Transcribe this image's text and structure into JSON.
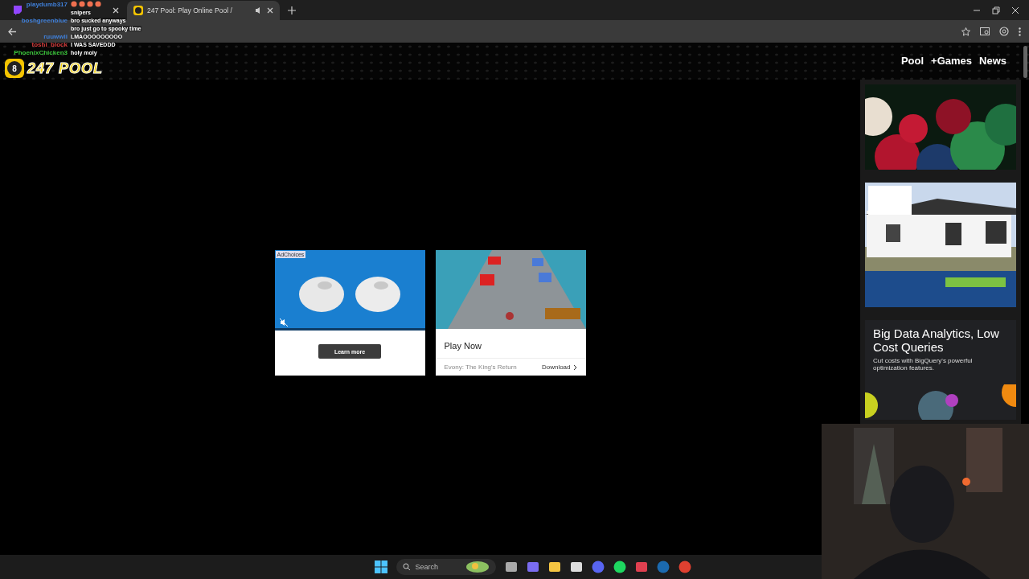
{
  "browser": {
    "tabs": [
      {
        "kind": "twitch",
        "selected": false
      },
      {
        "kind": "site",
        "title": "247 Pool: Play Online Pool /",
        "audio": true,
        "selected": true
      }
    ]
  },
  "site": {
    "logo_ball": "8",
    "logo_text": "247 POOL",
    "nav": [
      "Pool",
      "+Games",
      "News"
    ]
  },
  "center_ads": [
    {
      "kind": "video",
      "adchoices": "AdChoices",
      "muted": true,
      "button": "Learn more"
    },
    {
      "kind": "app",
      "title": "Play Now",
      "advertiser": "Evony: The King's Return",
      "action": "Download"
    }
  ],
  "sidebar_ads": [
    {
      "kind": "picture"
    },
    {
      "kind": "picture"
    },
    {
      "kind": "text",
      "headline": "Big Data Analytics, Low Cost Queries",
      "body": "Cut costs with BigQuery's powerful optimization features."
    }
  ],
  "chat": [
    {
      "kind": "emotes",
      "user": "playdumb317",
      "color": "#3f7fd8"
    },
    {
      "kind": "text",
      "text": "snipers"
    },
    {
      "kind": "text",
      "user": "boshgreenblue",
      "text": "bro sucked anyways",
      "color": "#3f7fd8"
    },
    {
      "kind": "text",
      "text": "bro just go to spooky time"
    },
    {
      "kind": "text",
      "user": "ruuwwii",
      "text": "LMAOOOOOOOOO",
      "color": "#3f7fd8"
    },
    {
      "kind": "text",
      "user": "toshi_block",
      "text": "I WAS SAVEDDD",
      "color": "#d83c3c"
    },
    {
      "kind": "text",
      "user": "PhoenixChicken3",
      "text": "holy moly",
      "color": "#3cc83c"
    }
  ],
  "taskbar": {
    "search_placeholder": "Search",
    "apps": [
      {
        "kind": "files"
      },
      {
        "kind": "copilot"
      },
      {
        "kind": "folder"
      },
      {
        "kind": "store"
      },
      {
        "kind": "discord"
      },
      {
        "kind": "spotify"
      },
      {
        "kind": "game"
      },
      {
        "kind": "steam"
      },
      {
        "kind": "chrome"
      }
    ]
  }
}
